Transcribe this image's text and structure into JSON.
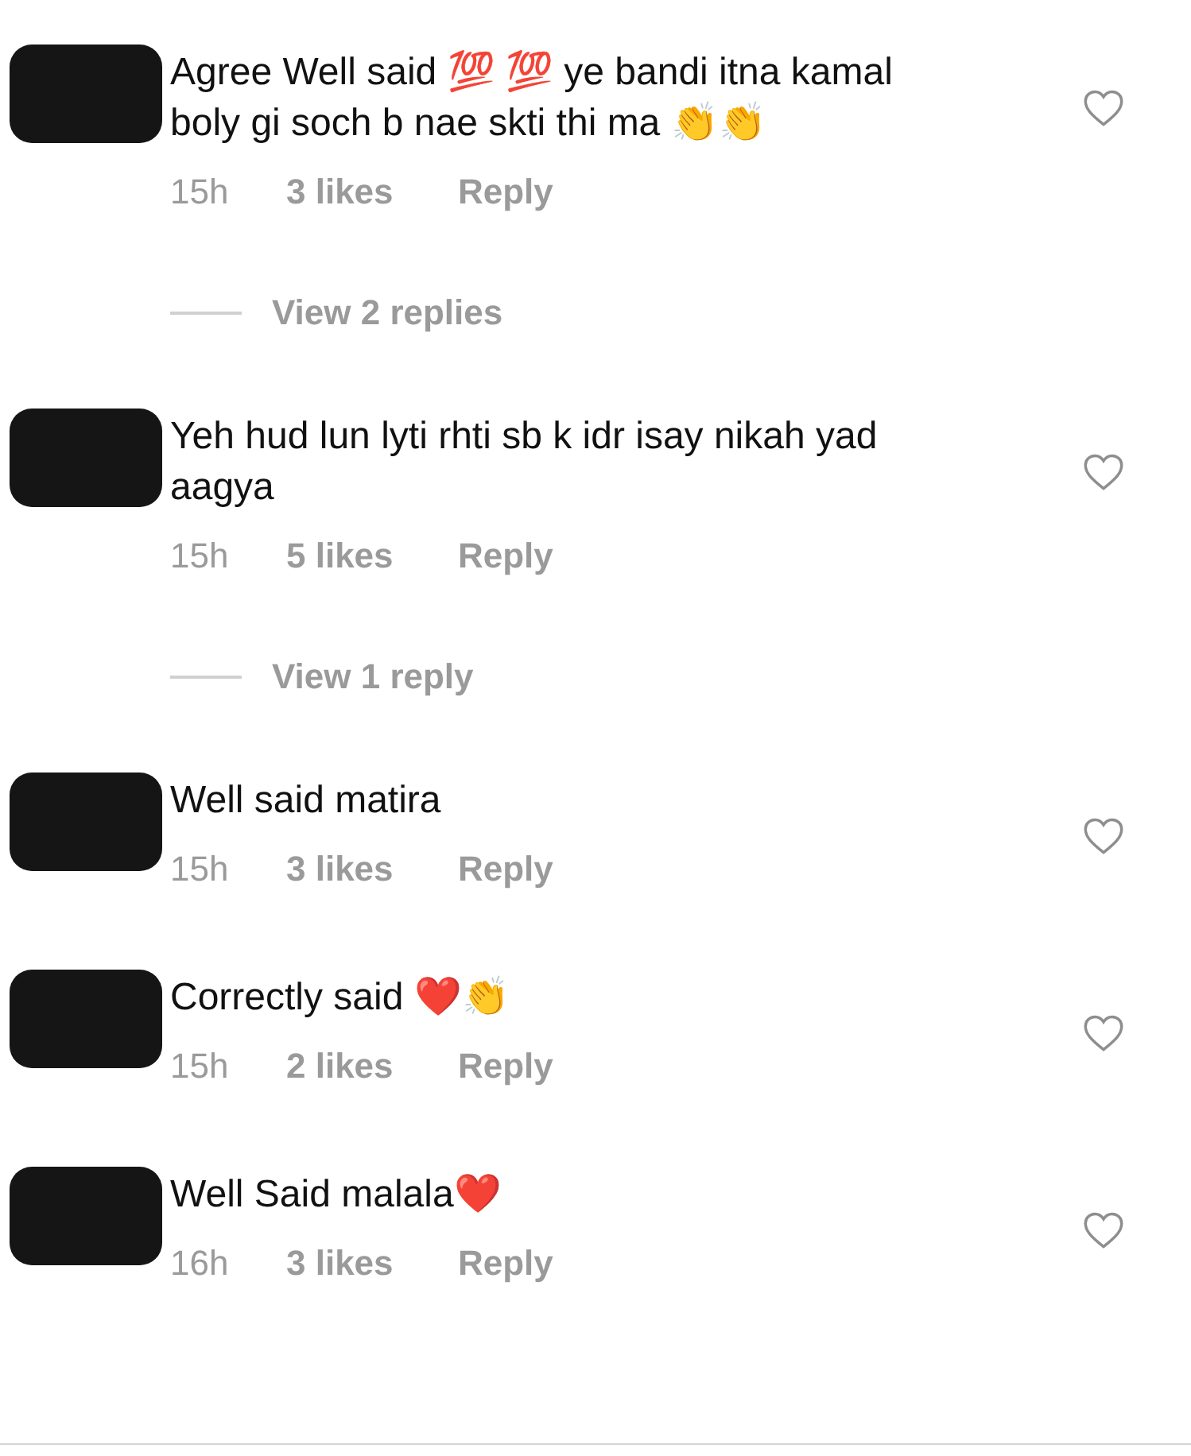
{
  "comments": [
    {
      "text": "Agree Well said 💯 💯  ye bandi itna kamal boly gi soch b nae skti thi ma 👏👏",
      "time": "15h",
      "likes": "3 likes",
      "reply": "Reply",
      "liked": false,
      "view_replies": "View 2 replies"
    },
    {
      "text": "Yeh hud lun lyti rhti sb k idr isay nikah yad aagya",
      "time": "15h",
      "likes": "5 likes",
      "reply": "Reply",
      "liked": false,
      "view_replies": "View 1 reply"
    },
    {
      "text": "Well said matira",
      "time": "15h",
      "likes": "3 likes",
      "reply": "Reply",
      "liked": false
    },
    {
      "text": "Correctly said ❤️👏",
      "time": "15h",
      "likes": "2 likes",
      "reply": "Reply",
      "liked": false
    },
    {
      "text": "Well Said malala❤️",
      "time": "16h",
      "likes": "3 likes",
      "reply": "Reply",
      "liked": false
    }
  ]
}
